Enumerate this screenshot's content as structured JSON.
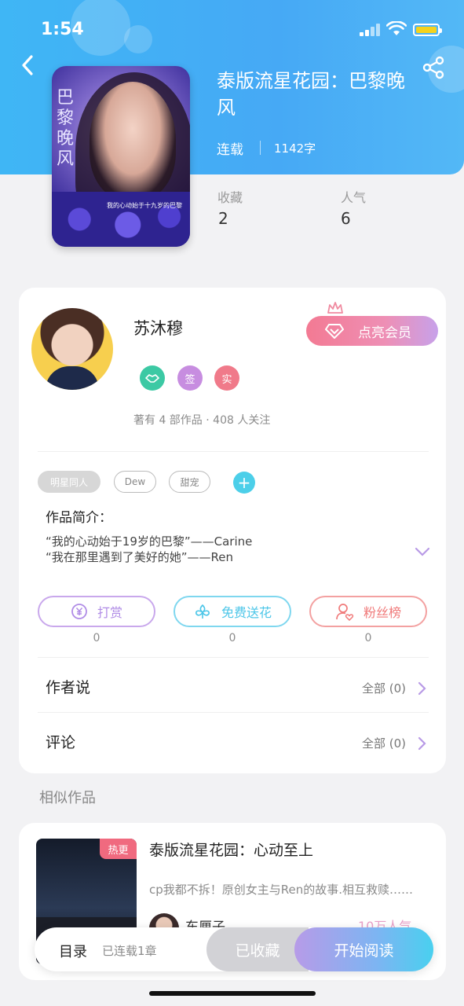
{
  "status_bar": {
    "time": "1:54"
  },
  "book": {
    "title": "泰版流星花园：巴黎晚风",
    "status": "连载",
    "word_count": "1142字",
    "cover_title": "巴黎晚风",
    "cover_caption": "我的心动始于十九岁的巴黎",
    "stats": [
      {
        "label": "收藏",
        "value": "2"
      },
      {
        "label": "人气",
        "value": "6"
      }
    ]
  },
  "author": {
    "name": "苏沐穆",
    "vip_button": "点亮会员",
    "badges": [
      {
        "icon": "handshake-icon",
        "text": "",
        "color": "#3cc9a4"
      },
      {
        "icon": "sign-badge",
        "text": "签",
        "color": "#c78de0"
      },
      {
        "icon": "real-badge",
        "text": "实",
        "color": "#f07a8a"
      }
    ],
    "meta": "著有 4 部作品 · 408 人关注"
  },
  "tags": [
    "明星同人",
    "Dew",
    "甜宠"
  ],
  "intro": {
    "label": "作品简介：",
    "lines": [
      "“我的心动始于19岁的巴黎”——Carine",
      "“我在那里遇到了美好的她”——Ren"
    ]
  },
  "actions": [
    {
      "label": "打赏",
      "count": "0",
      "icon": "yen-coin-icon",
      "color": "#b08ce6"
    },
    {
      "label": "免费送花",
      "count": "0",
      "icon": "flower-icon",
      "color": "#4cc6e8"
    },
    {
      "label": "粉丝榜",
      "count": "0",
      "icon": "fan-person-icon",
      "color": "#f07a7a"
    }
  ],
  "rows": [
    {
      "label": "作者说",
      "right": "全部 (0)"
    },
    {
      "label": "评论",
      "right": "全部 (0)"
    }
  ],
  "similar": {
    "label": "相似作品",
    "items": [
      {
        "badge": "热更",
        "title": "泰版流星花园：心动至上",
        "desc": "cp我都不拆！原创女主与Ren的故事.相互救赎……",
        "author": "东厘子",
        "popularity": "10万人气"
      }
    ]
  },
  "bottom_bar": {
    "toc_label": "目录",
    "toc_count": "已连载1章",
    "collected_label": "已收藏",
    "read_label": "开始阅读"
  },
  "colors": {
    "header": "#46a9f5",
    "accent_pink": "#f37a93",
    "accent_cyan": "#4ccfe9"
  }
}
